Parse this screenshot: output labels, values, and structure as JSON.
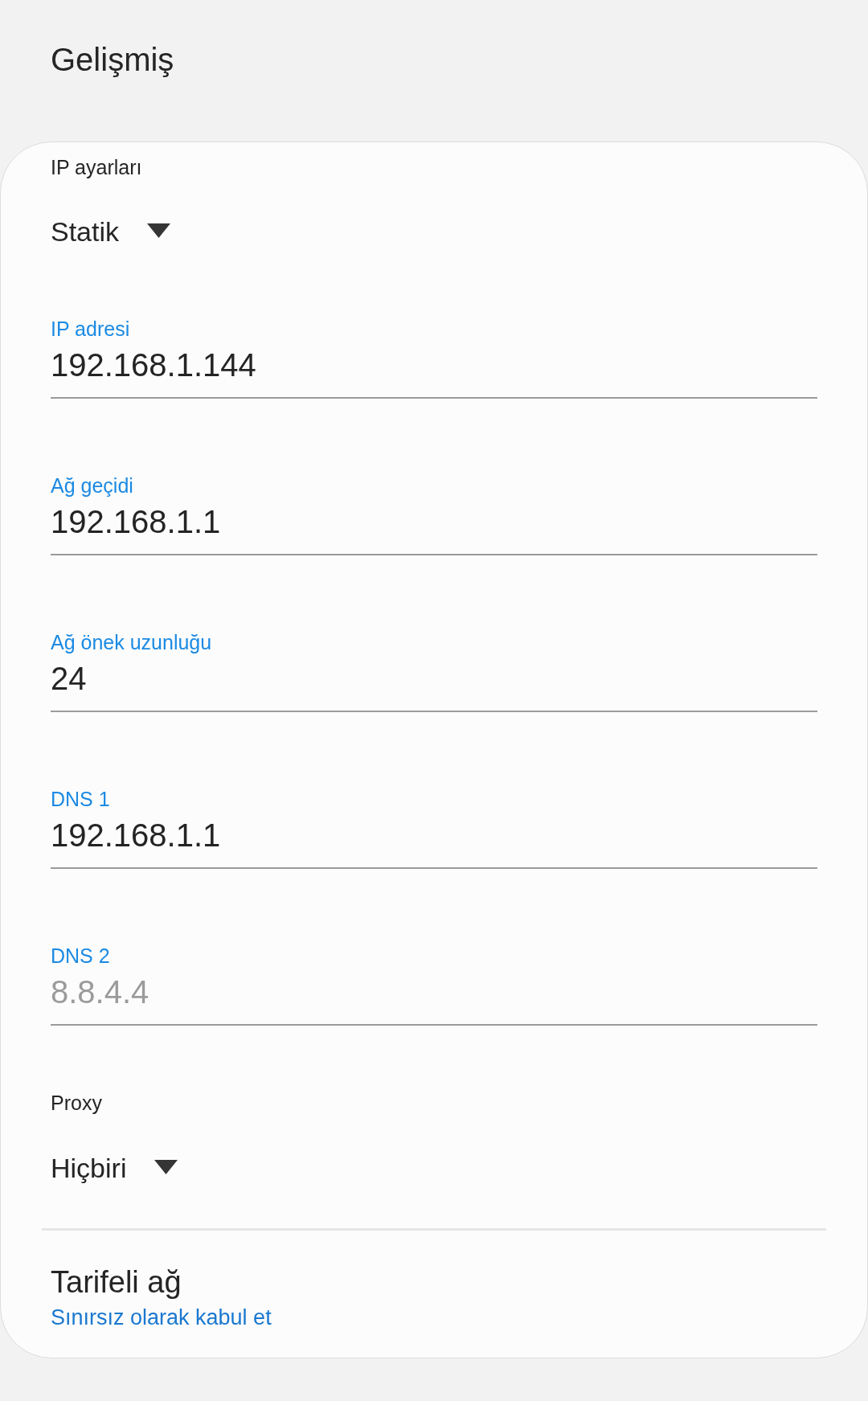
{
  "title": "Gelişmiş",
  "ip_settings": {
    "label": "IP ayarları",
    "value": "Statik"
  },
  "fields": [
    {
      "label": "IP adresi",
      "value": "192.168.1.144"
    },
    {
      "label": "Ağ geçidi",
      "value": "192.168.1.1"
    },
    {
      "label": "Ağ önek uzunluğu",
      "value": "24"
    },
    {
      "label": "DNS 1",
      "value": "192.168.1.1"
    },
    {
      "label": "DNS 2",
      "placeholder": "8.8.4.4"
    }
  ],
  "proxy": {
    "label": "Proxy",
    "value": "Hiçbiri"
  },
  "metered_network": {
    "title": "Tarifeli ağ",
    "value": "Sınırsız olarak kabul et"
  }
}
